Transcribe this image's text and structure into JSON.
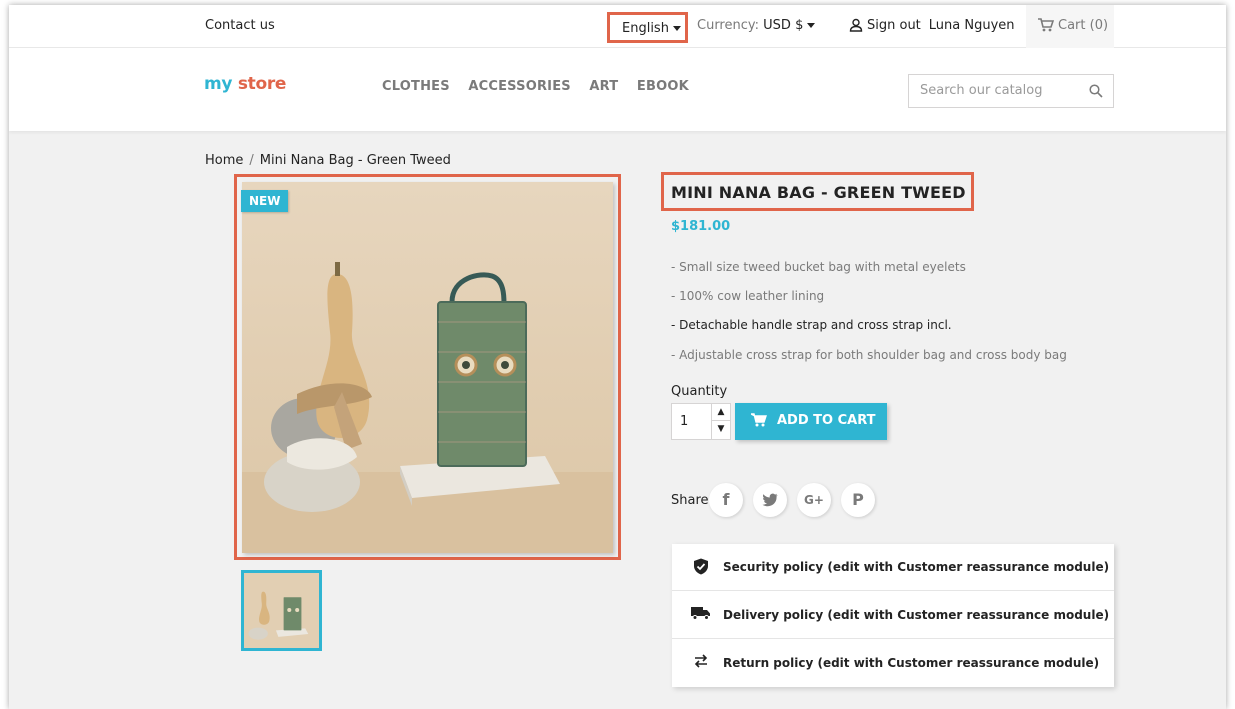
{
  "topbar": {
    "contact": "Contact us",
    "language": "English",
    "currency_label": "Currency:",
    "currency_value": "USD $",
    "signout": "Sign out",
    "username": "Luna Nguyen",
    "cart": "Cart (0)"
  },
  "header": {
    "logo_part1": "my",
    "logo_part2": "store",
    "nav": [
      "CLOTHES",
      "ACCESSORIES",
      "ART",
      "EBOOK"
    ],
    "search_placeholder": "Search our catalog"
  },
  "breadcrumb": {
    "home": "Home",
    "separator": "/",
    "current": "Mini Nana Bag - Green Tweed"
  },
  "product": {
    "badge": "NEW",
    "title": "MINI NANA BAG - GREEN TWEED",
    "price": "$181.00",
    "description": [
      "- Small size tweed bucket bag with metal eyelets",
      "- 100% cow leather lining",
      "- Detachable handle strap and cross strap incl.",
      "- Adjustable cross strap for both shoulder bag and cross body bag"
    ],
    "quantity_label": "Quantity",
    "quantity_value": "1",
    "add_to_cart": "ADD TO CART",
    "share_label": "Share",
    "social": [
      "f",
      "G+",
      "P"
    ]
  },
  "reassurance": [
    {
      "icon": "shield-check-icon",
      "label": "Security policy (edit with Customer reassurance module)"
    },
    {
      "icon": "truck-icon",
      "label": "Delivery policy (edit with Customer reassurance module)"
    },
    {
      "icon": "swap-arrows-icon",
      "label": "Return policy (edit with Customer reassurance module)"
    }
  ],
  "colors": {
    "accent": "#2fb5d2",
    "highlight": "#e0654a",
    "background": "#f1f1f1"
  }
}
